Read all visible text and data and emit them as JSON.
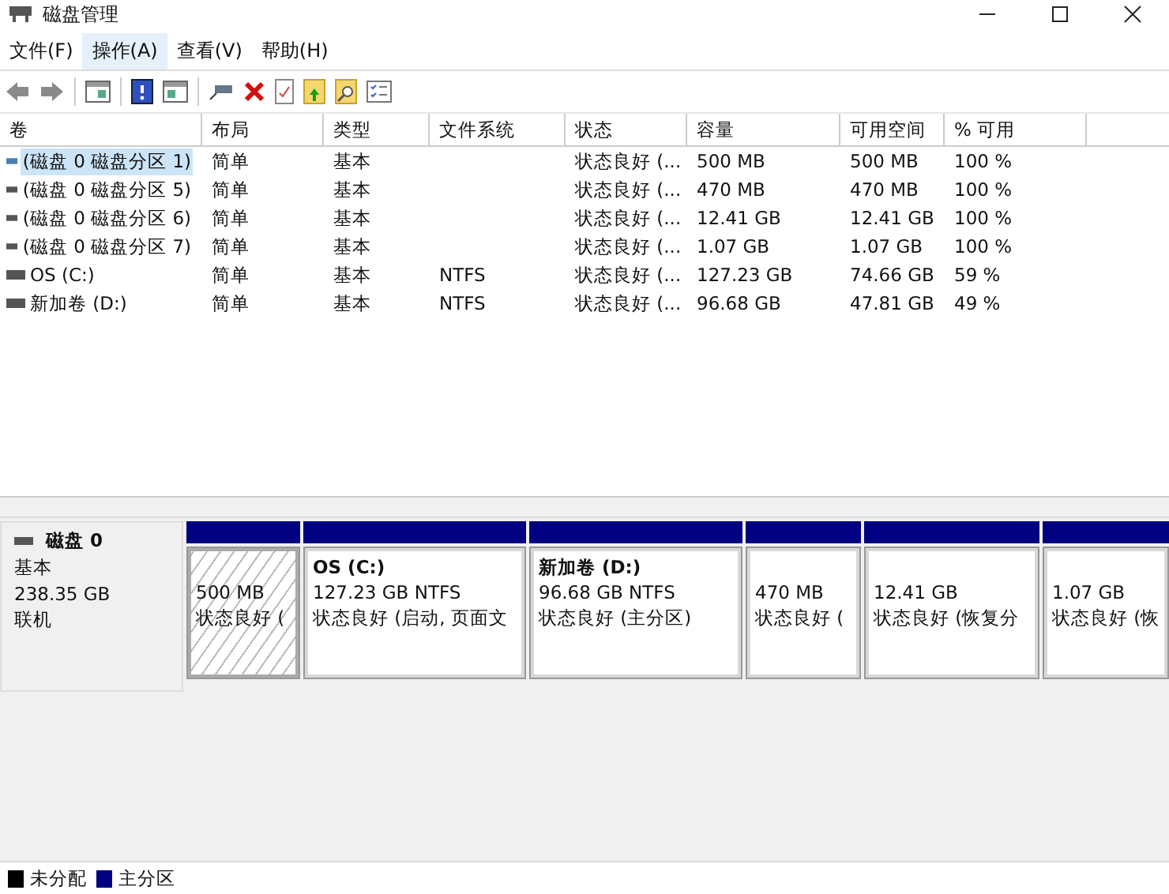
{
  "window": {
    "title": "磁盘管理"
  },
  "menu": [
    {
      "label": "文件(F)",
      "selected": false
    },
    {
      "label": "操作(A)",
      "selected": true
    },
    {
      "label": "查看(V)",
      "selected": false
    },
    {
      "label": "帮助(H)",
      "selected": false
    }
  ],
  "table": {
    "columns": [
      "卷",
      "布局",
      "类型",
      "文件系统",
      "状态",
      "容量",
      "可用空间",
      "% 可用"
    ],
    "rows": [
      {
        "selected": true,
        "cells": [
          "(磁盘 0 磁盘分区 1)",
          "简单",
          "基本",
          null,
          "状态良好 (...",
          "500 MB",
          "500 MB",
          "100 %"
        ]
      },
      {
        "selected": false,
        "cells": [
          "(磁盘 0 磁盘分区 5)",
          "简单",
          "基本",
          null,
          "状态良好 (...",
          "470 MB",
          "470 MB",
          "100 %"
        ]
      },
      {
        "selected": false,
        "cells": [
          "(磁盘 0 磁盘分区 6)",
          "简单",
          "基本",
          null,
          "状态良好 (...",
          "12.41 GB",
          "12.41 GB",
          "100 %"
        ]
      },
      {
        "selected": false,
        "cells": [
          "(磁盘 0 磁盘分区 7)",
          "简单",
          "基本",
          null,
          "状态良好 (...",
          "1.07 GB",
          "1.07 GB",
          "100 %"
        ]
      },
      {
        "selected": false,
        "cells": [
          "OS (C:)",
          "简单",
          "基本",
          "NTFS",
          "状态良好 (...",
          "127.23 GB",
          "74.66 GB",
          "59 %"
        ]
      },
      {
        "selected": false,
        "cells": [
          "新加卷 (D:)",
          "简单",
          "基本",
          "NTFS",
          "状态良好 (...",
          "96.68 GB",
          "47.81 GB",
          "49 %"
        ]
      }
    ]
  },
  "disk": {
    "name": "磁盘 0",
    "type": "基本",
    "size": "238.35 GB",
    "status": "联机",
    "partitions": [
      {
        "selected": true,
        "size": "500 MB",
        "status": "状态良好 ("
      },
      {
        "selected": false,
        "name": "OS  (C:)",
        "size": "127.23 GB NTFS",
        "status": "状态良好 (启动, 页面文"
      },
      {
        "selected": false,
        "name": "新加卷  (D:)",
        "size": "96.68 GB NTFS",
        "status": "状态良好 (主分区)"
      },
      {
        "selected": false,
        "size": "470 MB",
        "status": "状态良好 ("
      },
      {
        "selected": false,
        "size": "12.41 GB",
        "status": "状态良好 (恢复分"
      },
      {
        "selected": false,
        "size": "1.07 GB",
        "status": "状态良好 (恢"
      }
    ]
  },
  "legend": [
    {
      "label": "未分配",
      "color": "#000000"
    },
    {
      "label": "主分区",
      "color": "#000080"
    }
  ]
}
